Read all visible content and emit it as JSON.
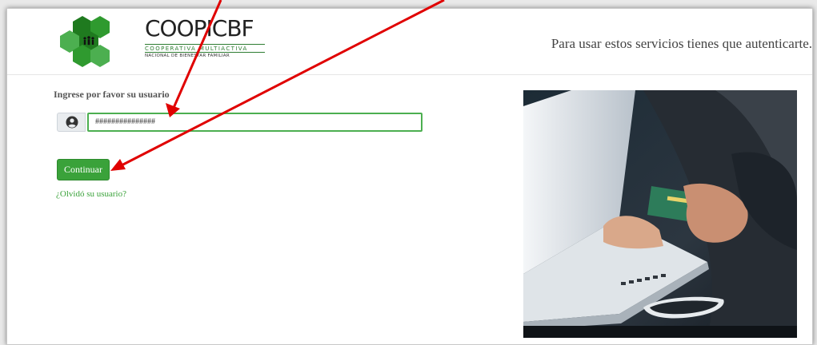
{
  "logo": {
    "title": "COOPICBF",
    "line1": "COOPERATIVA MULTIACTIVA",
    "line2": "NACIONAL DE BIENESTAR FAMILIAR"
  },
  "header": {
    "message": "Para usar estos servicios tienes que autenticarte."
  },
  "login": {
    "label": "Ingrese por favor su usuario",
    "username_value": "###############",
    "user_icon": "user-circle-icon",
    "continue_label": "Continuar",
    "forgot_label": "¿Olvidó su usuario?"
  },
  "colors": {
    "accent_green": "#3aa23a",
    "logo_green": "#2e7d32",
    "annotation_red": "#e00000"
  },
  "image": {
    "subject": "hands holding credit card at laptop with phone"
  }
}
